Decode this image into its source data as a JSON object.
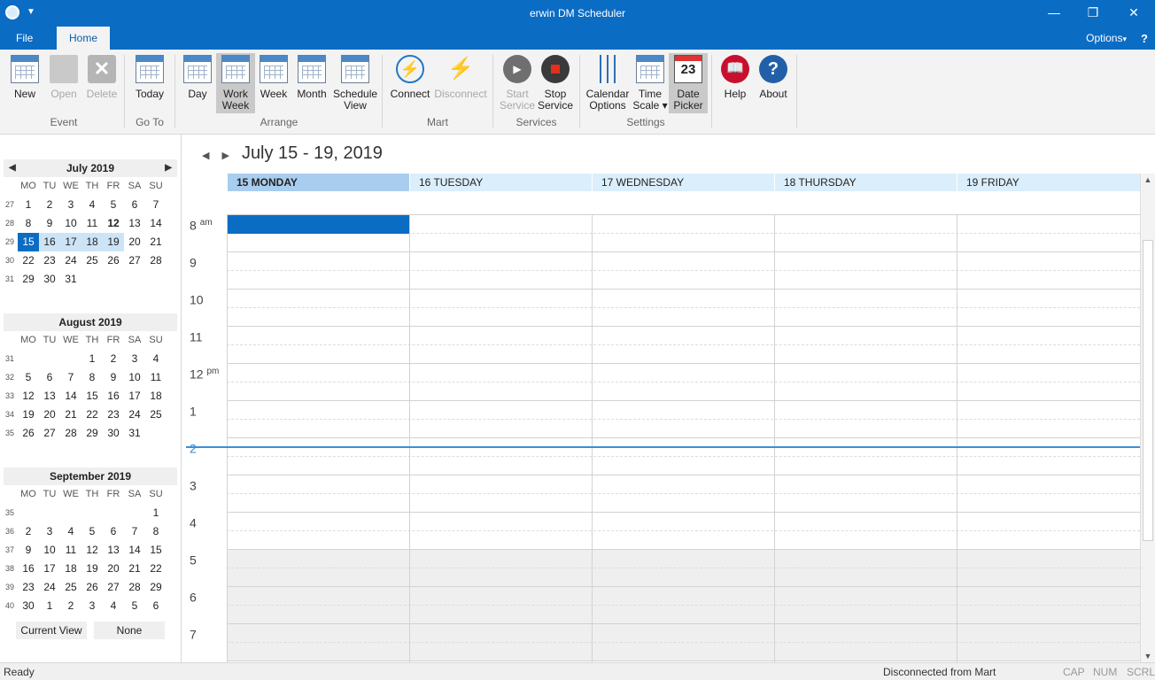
{
  "window": {
    "title": "erwin DM Scheduler"
  },
  "ribbon_tabs": [
    {
      "label": "File"
    },
    {
      "label": "Home"
    }
  ],
  "options_label": "Options",
  "options_arrow": "▾",
  "help_glyph": "?",
  "window_buttons": {
    "minimize": "—",
    "restore": "❐",
    "close": "✕"
  },
  "ribbon": {
    "groups": [
      {
        "label": "Event"
      },
      {
        "label": "Go To"
      },
      {
        "label": "Arrange"
      },
      {
        "label": "Mart"
      },
      {
        "label": "Services"
      },
      {
        "label": "Settings"
      }
    ],
    "buttons": {
      "new": {
        "line1": "New",
        "line2": ""
      },
      "open": {
        "line1": "Open",
        "line2": ""
      },
      "delete": {
        "line1": "Delete",
        "line2": ""
      },
      "today": {
        "line1": "Today",
        "line2": ""
      },
      "day": {
        "line1": "Day",
        "line2": ""
      },
      "work_week": {
        "line1": "Work",
        "line2": "Week"
      },
      "week": {
        "line1": "Week",
        "line2": ""
      },
      "month": {
        "line1": "Month",
        "line2": ""
      },
      "schedule_view": {
        "line1": "Schedule",
        "line2": "View"
      },
      "connect": {
        "line1": "Connect",
        "line2": ""
      },
      "disconnect": {
        "line1": "Disconnect",
        "line2": ""
      },
      "start_service": {
        "line1": "Start",
        "line2": "Service"
      },
      "stop_service": {
        "line1": "Stop",
        "line2": "Service"
      },
      "calendar_options": {
        "line1": "Calendar",
        "line2": "Options"
      },
      "time_scale": {
        "line1": "Time",
        "line2": "Scale ▾"
      },
      "date_picker": {
        "line1": "Date",
        "line2": "Picker",
        "icon_text": "23"
      },
      "help": {
        "line1": "Help",
        "line2": ""
      },
      "about": {
        "line1": "About",
        "line2": ""
      }
    }
  },
  "nav_calendars": {
    "dow": [
      "MO",
      "TU",
      "WE",
      "TH",
      "FR",
      "SA",
      "SU"
    ],
    "months": [
      {
        "title": "July 2019",
        "weeks": [
          {
            "wk": "27",
            "days": [
              "1",
              "2",
              "3",
              "4",
              "5",
              "6",
              "7"
            ]
          },
          {
            "wk": "28",
            "days": [
              "8",
              "9",
              "10",
              "11",
              "12",
              "13",
              "14"
            ]
          },
          {
            "wk": "29",
            "days": [
              "15",
              "16",
              "17",
              "18",
              "19",
              "20",
              "21"
            ]
          },
          {
            "wk": "30",
            "days": [
              "22",
              "23",
              "24",
              "25",
              "26",
              "27",
              "28"
            ]
          },
          {
            "wk": "31",
            "days": [
              "29",
              "30",
              "31",
              "",
              "",
              "",
              ""
            ]
          }
        ]
      },
      {
        "title": "August 2019",
        "weeks": [
          {
            "wk": "31",
            "days": [
              "",
              "",
              "",
              "1",
              "2",
              "3",
              "4"
            ]
          },
          {
            "wk": "32",
            "days": [
              "5",
              "6",
              "7",
              "8",
              "9",
              "10",
              "11"
            ]
          },
          {
            "wk": "33",
            "days": [
              "12",
              "13",
              "14",
              "15",
              "16",
              "17",
              "18"
            ]
          },
          {
            "wk": "34",
            "days": [
              "19",
              "20",
              "21",
              "22",
              "23",
              "24",
              "25"
            ]
          },
          {
            "wk": "35",
            "days": [
              "26",
              "27",
              "28",
              "29",
              "30",
              "31",
              ""
            ]
          }
        ]
      },
      {
        "title": "September 2019",
        "weeks": [
          {
            "wk": "35",
            "days": [
              "",
              "",
              "",
              "",
              "",
              "",
              "1"
            ]
          },
          {
            "wk": "36",
            "days": [
              "2",
              "3",
              "4",
              "5",
              "6",
              "7",
              "8"
            ]
          },
          {
            "wk": "37",
            "days": [
              "9",
              "10",
              "11",
              "12",
              "13",
              "14",
              "15"
            ]
          },
          {
            "wk": "38",
            "days": [
              "16",
              "17",
              "18",
              "19",
              "20",
              "21",
              "22"
            ]
          },
          {
            "wk": "39",
            "days": [
              "23",
              "24",
              "25",
              "26",
              "27",
              "28",
              "29"
            ]
          },
          {
            "wk": "40",
            "days": [
              "30",
              "1",
              "2",
              "3",
              "4",
              "5",
              "6"
            ]
          }
        ]
      }
    ],
    "buttons": {
      "current_view": "Current View",
      "none": "None"
    }
  },
  "main": {
    "range_title": "July 15 - 19, 2019",
    "days": [
      "15 MONDAY",
      "16 TUESDAY",
      "17 WEDNESDAY",
      "18 THURSDAY",
      "19 FRIDAY"
    ],
    "hours": [
      {
        "h": "8",
        "suffix": "am"
      },
      {
        "h": "9",
        "suffix": ""
      },
      {
        "h": "10",
        "suffix": ""
      },
      {
        "h": "11",
        "suffix": ""
      },
      {
        "h": "12",
        "suffix": "pm"
      },
      {
        "h": "1",
        "suffix": ""
      },
      {
        "h": "2",
        "suffix": ""
      },
      {
        "h": "3",
        "suffix": ""
      },
      {
        "h": "4",
        "suffix": ""
      },
      {
        "h": "5",
        "suffix": ""
      },
      {
        "h": "6",
        "suffix": ""
      },
      {
        "h": "7",
        "suffix": ""
      }
    ]
  },
  "status": {
    "left": "Ready",
    "connection": "Disconnected from Mart",
    "cap": "CAP",
    "num": "NUM",
    "scrl": "SCRL"
  },
  "colors": {
    "accent": "#0b6cc4",
    "selected_day": "#a9cdef",
    "off_hours": "#efefef"
  }
}
